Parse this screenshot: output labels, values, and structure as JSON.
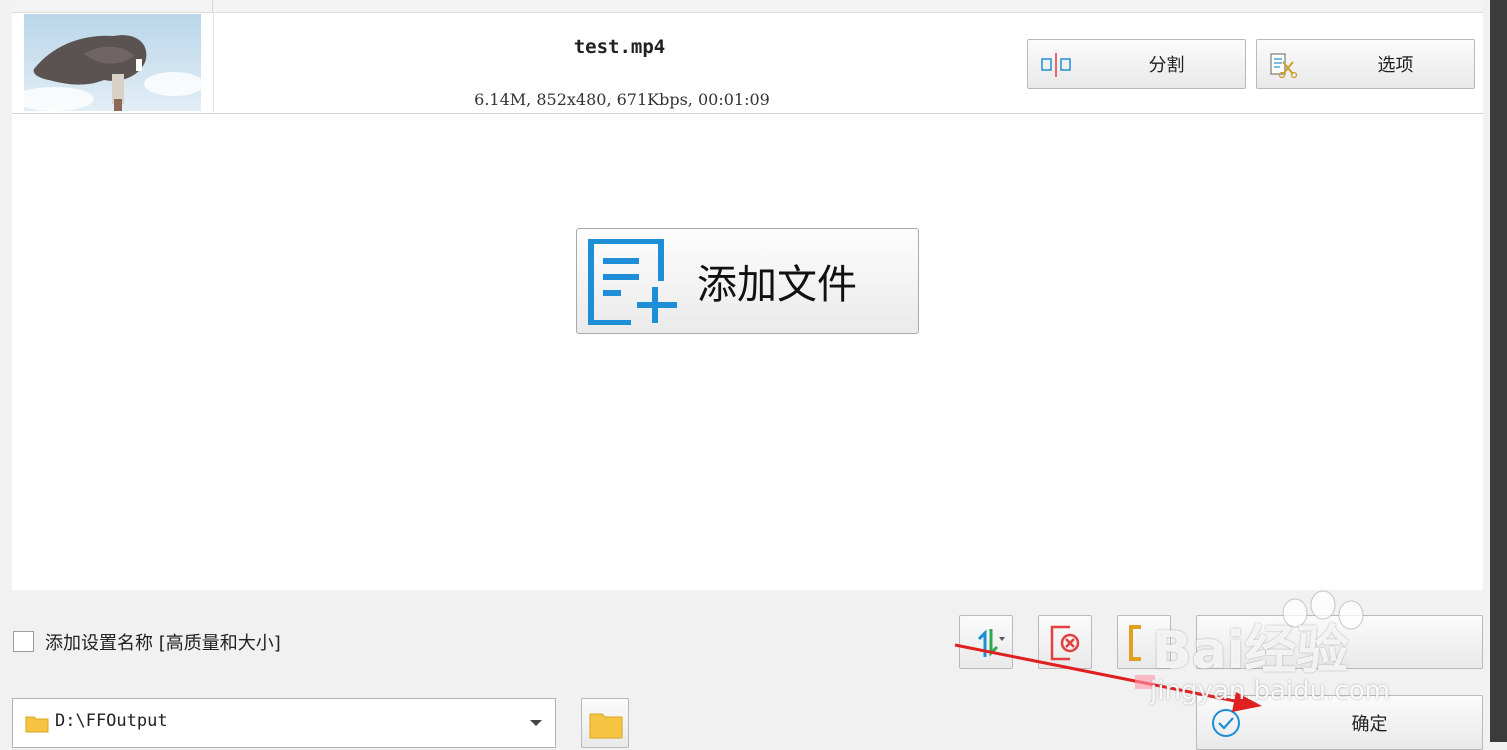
{
  "file_list": {
    "row": {
      "name": "test.mp4",
      "meta": "6.14M, 852x480, 671Kbps, 00:01:09",
      "split_label": "分割",
      "options_label": "选项"
    }
  },
  "add_file": {
    "label": "添加文件"
  },
  "settings": {
    "checkbox_label": "添加设置名称 [高质量和大小]",
    "checked": false
  },
  "output": {
    "path": "D:\\FFOutput"
  },
  "actions": {
    "ok_label": "确定"
  },
  "watermark": {
    "brand": "Bai经验",
    "site": "jingyan.baidu.com"
  },
  "colors": {
    "accent": "#1e8fd6",
    "annotation": "#e02020",
    "folder": "#f5c542"
  }
}
